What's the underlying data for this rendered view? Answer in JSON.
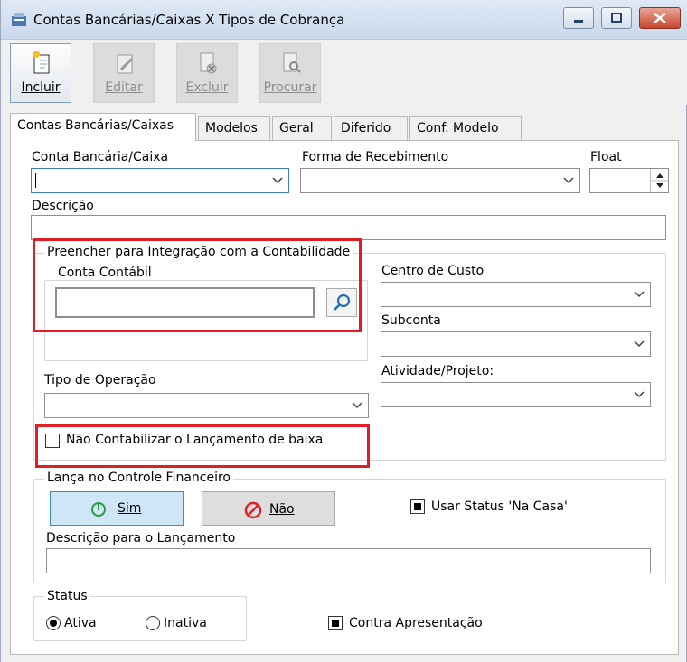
{
  "window": {
    "title": "Contas Bancárias/Caixas X Tipos de Cobrança"
  },
  "toolbar": {
    "incluir": "Incluir",
    "editar": "Editar",
    "excluir": "Excluir",
    "procurar": "Procurar"
  },
  "tabs": [
    "Contas Bancárias/Caixas",
    "Modelos",
    "Geral",
    "Diferido",
    "Conf. Modelo"
  ],
  "form": {
    "conta_bancaria_label": "Conta Bancária/Caixa",
    "forma_recebimento_label": "Forma de Recebimento",
    "float_label": "Float",
    "descricao_label": "Descrição",
    "integracao_group": "Preencher para Integração com a Contabilidade",
    "conta_contabil_label": "Conta Contábil",
    "centro_custo_label": "Centro de Custo",
    "subconta_label": "Subconta",
    "atividade_label": "Atividade/Projeto:",
    "tipo_operacao_label": "Tipo de Operação",
    "nao_contabilizar_label": "Não Contabilizar o Lançamento de baixa",
    "controle_financeiro_group": "Lança no Controle Financeiro",
    "sim_label": "Sim",
    "nao_label": "Não",
    "usar_status_label": "Usar Status 'Na Casa'",
    "descricao_lancamento_label": "Descrição para o Lançamento",
    "status_group": "Status",
    "ativa_label": "Ativa",
    "inativa_label": "Inativa",
    "contra_apresentacao_label": "Contra Apresentação"
  },
  "state": {
    "status_selected": "Ativa",
    "usar_status_checked": true,
    "contra_apresentacao_checked": true,
    "nao_contabilizar_checked": false
  }
}
